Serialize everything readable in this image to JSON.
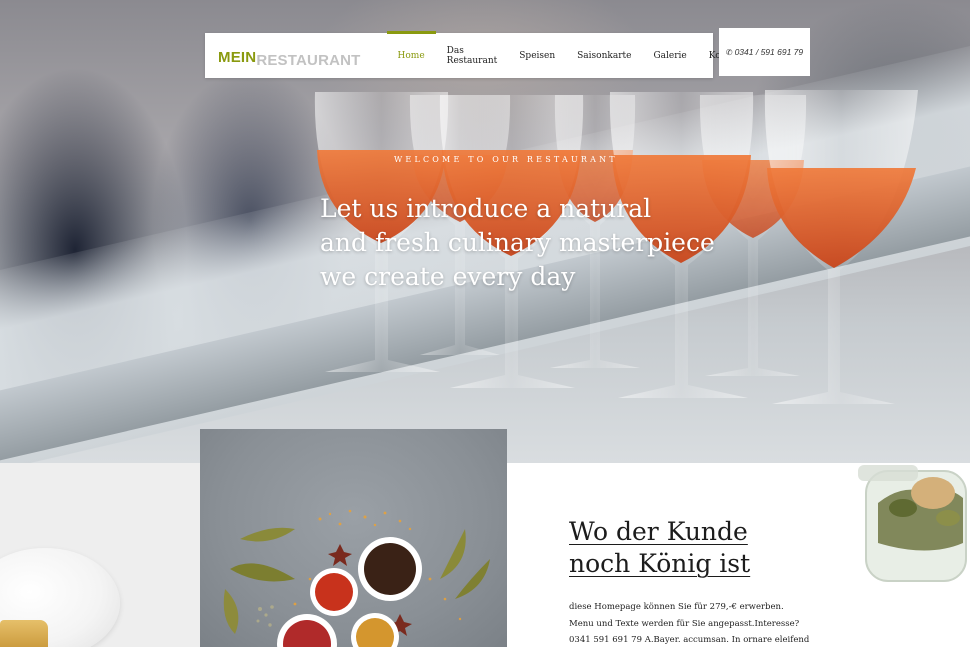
{
  "header": {
    "logo": {
      "part1": "MEIN",
      "part2": "RESTAURANT"
    },
    "nav": [
      {
        "label": "Home",
        "active": true
      },
      {
        "label": "Das Restaurant",
        "active": false
      },
      {
        "label": "Speisen",
        "active": false
      },
      {
        "label": "Saisonkarte",
        "active": false
      },
      {
        "label": "Galerie",
        "active": false
      },
      {
        "label": "Kontakt",
        "active": false
      }
    ],
    "phone": {
      "icon": "phone-icon",
      "number": "0341 / 591 691 79"
    }
  },
  "hero": {
    "kicker": "WELCOME TO OUR RESTAURANT",
    "headline_lines": [
      "Let us introduce a natural",
      "and fresh culinary masterpiece",
      "we create every day"
    ]
  },
  "about": {
    "title_lines": [
      "Wo der Kunde",
      "noch König ist"
    ],
    "body_lines": [
      "diese Homepage können Sie für 279,-€ erwerben.",
      "Menu und Texte werden für Sie angepasst.Interesse?",
      "0341 591 691 79 A.Bayer. accumsan. In ornare eleifend"
    ]
  },
  "colors": {
    "accent": "#8a9a0f",
    "logo_secondary": "#c2c2c2",
    "text_dark": "#1c1c1c"
  }
}
